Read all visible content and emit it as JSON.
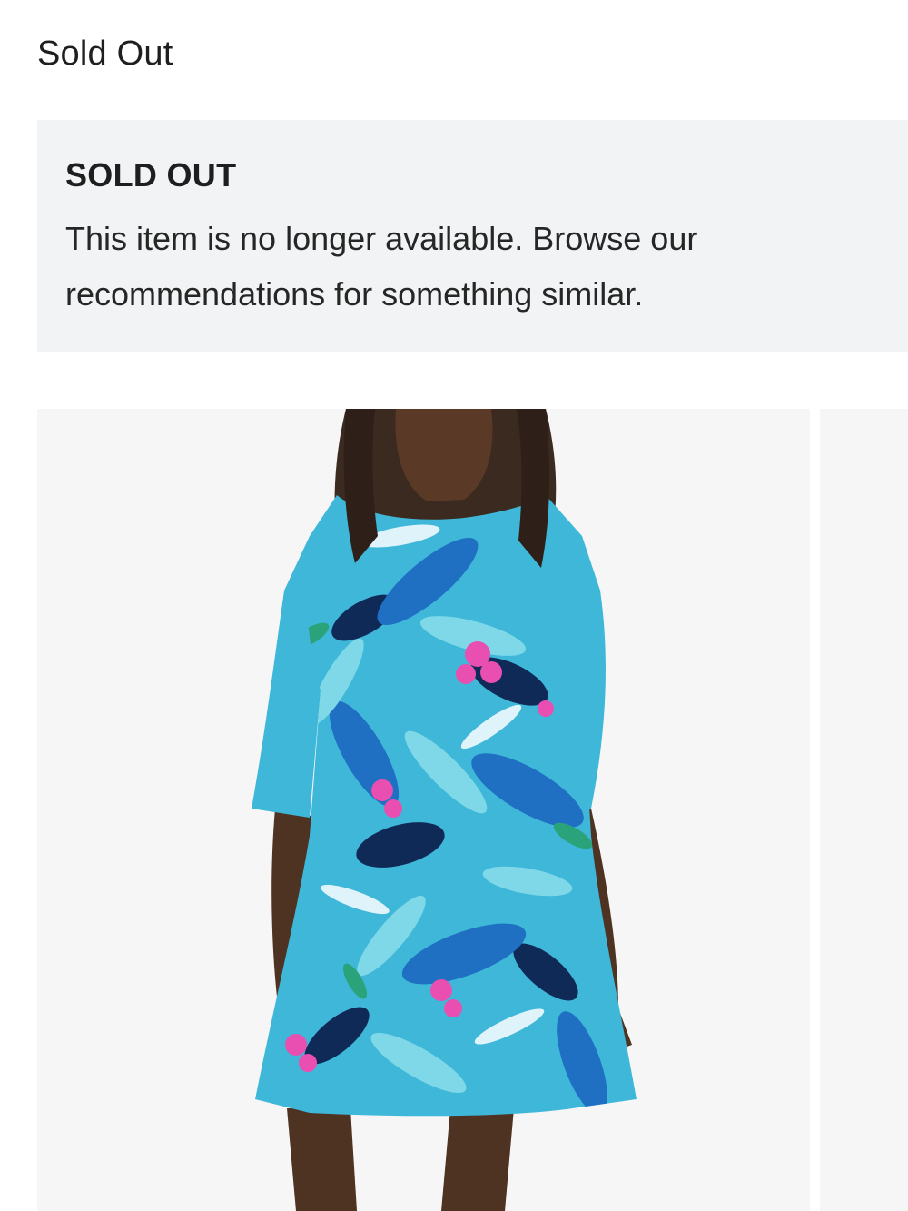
{
  "header": {
    "title": "Sold Out"
  },
  "notice": {
    "title": "SOLD OUT",
    "message": "This item is no longer available. Browse our recommendations for something similar."
  },
  "gallery": {
    "images": [
      {
        "name": "product-photo-dress",
        "palette": [
          "#3fb7d9",
          "#1f6fc3",
          "#0f2a57",
          "#7fd8e8",
          "#e84fb0",
          "#2aa37a",
          "#dff4fa"
        ]
      },
      {
        "name": "product-photo-next"
      }
    ]
  },
  "colors": {
    "notice_background": "#f1f3f4",
    "photo_background": "#f6f6f6"
  }
}
